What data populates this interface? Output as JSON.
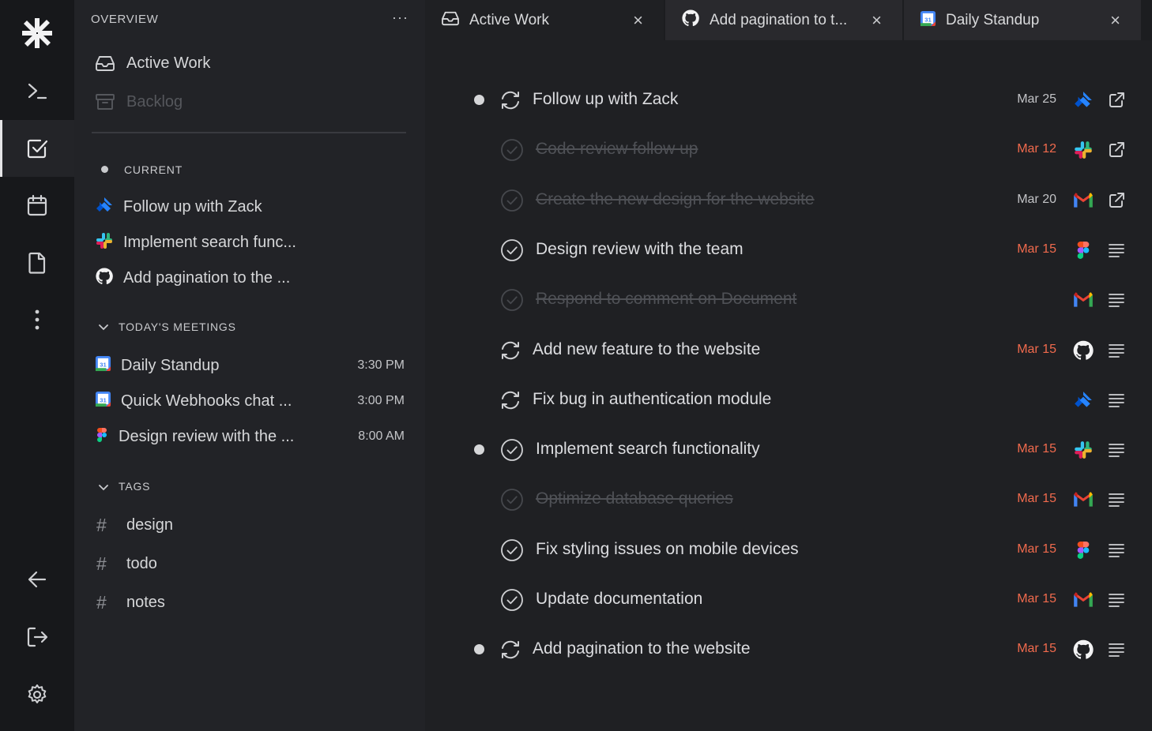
{
  "sidebar": {
    "overview_title": "OVERVIEW",
    "more_label": "···",
    "nav": [
      {
        "label": "Active Work",
        "icon": "inbox-icon"
      },
      {
        "label": "Backlog",
        "icon": "archive-icon"
      }
    ],
    "current_title": "CURRENT",
    "current_items": [
      {
        "label": "Follow up with Zack",
        "icon": "jira-icon"
      },
      {
        "label": "Implement search func...",
        "icon": "slack-icon"
      },
      {
        "label": "Add pagination to the ...",
        "icon": "github-icon"
      }
    ],
    "meetings_title": "TODAY'S MEETINGS",
    "meetings": [
      {
        "label": "Daily Standup",
        "time": "3:30 PM",
        "icon": "google-calendar-icon"
      },
      {
        "label": "Quick Webhooks chat ...",
        "time": "3:00 PM",
        "icon": "google-calendar-icon"
      },
      {
        "label": "Design review with the ...",
        "time": "8:00 AM",
        "icon": "figma-icon"
      }
    ],
    "tags_title": "TAGS",
    "tags": [
      {
        "hash": "#",
        "label": "design"
      },
      {
        "hash": "#",
        "label": "todo"
      },
      {
        "hash": "#",
        "label": "notes"
      }
    ]
  },
  "tabs": [
    {
      "label": "Active Work",
      "icon": "inbox-icon",
      "close": "×"
    },
    {
      "label": "Add pagination to t...",
      "icon": "github-icon",
      "close": "×"
    },
    {
      "label": "Daily Standup",
      "icon": "google-calendar-icon",
      "close": "×"
    }
  ],
  "tasks": [
    {
      "title": "Follow up with Zack",
      "date": "Mar 25",
      "date_overdue": false,
      "source": "jira-icon",
      "action": "external-link-icon",
      "status": "in-progress",
      "current": true,
      "done": false
    },
    {
      "title": "Code review follow up",
      "date": "Mar 12",
      "date_overdue": true,
      "source": "slack-icon",
      "action": "external-link-icon",
      "status": "check",
      "current": false,
      "done": true
    },
    {
      "title": "Create the new design for the website",
      "date": "Mar 20",
      "date_overdue": false,
      "source": "gmail-icon",
      "action": "external-link-icon",
      "status": "check",
      "current": false,
      "done": true
    },
    {
      "title": "Design review with the team",
      "date": "Mar 15",
      "date_overdue": true,
      "source": "figma-icon",
      "action": "notes-icon",
      "status": "check",
      "current": false,
      "done": false
    },
    {
      "title": "Respond to comment on Document",
      "date": "",
      "date_overdue": false,
      "source": "gmail-icon",
      "action": "notes-icon",
      "status": "check",
      "current": false,
      "done": true
    },
    {
      "title": "Add new feature to the website",
      "date": "Mar 15",
      "date_overdue": true,
      "source": "github-icon",
      "action": "notes-icon",
      "status": "in-progress",
      "current": false,
      "done": false
    },
    {
      "title": "Fix bug in authentication module",
      "date": "",
      "date_overdue": false,
      "source": "jira-icon",
      "action": "notes-icon",
      "status": "in-progress",
      "current": false,
      "done": false
    },
    {
      "title": "Implement search functionality",
      "date": "Mar 15",
      "date_overdue": true,
      "source": "slack-icon",
      "action": "notes-icon",
      "status": "check",
      "current": true,
      "done": false
    },
    {
      "title": "Optimize database queries",
      "date": "Mar 15",
      "date_overdue": true,
      "source": "gmail-icon",
      "action": "notes-icon",
      "status": "check",
      "current": false,
      "done": true
    },
    {
      "title": "Fix styling issues on mobile devices",
      "date": "Mar 15",
      "date_overdue": true,
      "source": "figma-icon",
      "action": "notes-icon",
      "status": "check",
      "current": false,
      "done": false
    },
    {
      "title": "Update documentation",
      "date": "Mar 15",
      "date_overdue": true,
      "source": "gmail-icon",
      "action": "notes-icon",
      "status": "check",
      "current": false,
      "done": false
    },
    {
      "title": "Add pagination to the website",
      "date": "Mar 15",
      "date_overdue": true,
      "source": "github-icon",
      "action": "notes-icon",
      "status": "in-progress",
      "current": true,
      "done": false
    }
  ],
  "colors": {
    "overdue": "#f06a4d",
    "background": "#1f2023",
    "sidebar": "#222327",
    "rail": "#17181b"
  }
}
